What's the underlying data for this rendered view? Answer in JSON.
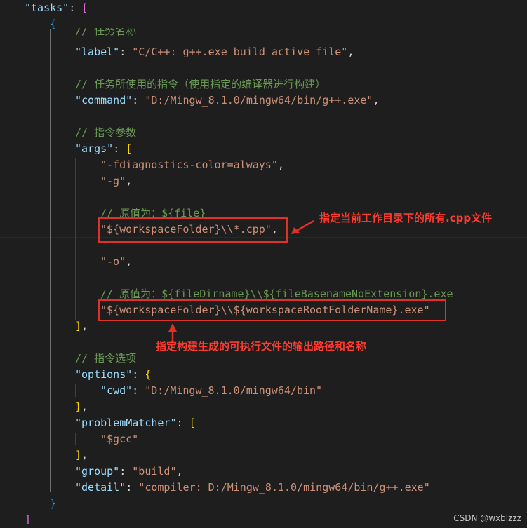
{
  "lines": {
    "l1": {
      "key": "\"tasks\"",
      "colon": ": ",
      "bracket": "["
    },
    "l2": {
      "brace": "{"
    },
    "l3": {
      "comment": "// 任务名称"
    },
    "l4": {
      "key": "\"label\"",
      "colon": ": ",
      "value": "\"C/C++: g++.exe build active file\"",
      "comma": ","
    },
    "l6": {
      "comment": "// 任务所使用的指令（使用指定的编译器进行构建）"
    },
    "l7": {
      "key": "\"command\"",
      "colon": ": ",
      "value": "\"D:/Mingw_8.1.0/mingw64/bin/g++.exe\"",
      "comma": ","
    },
    "l9": {
      "comment": "// 指令参数"
    },
    "l10": {
      "key": "\"args\"",
      "colon": ": ",
      "bracket": "["
    },
    "l11": {
      "value": "\"-fdiagnostics-color=always\"",
      "comma": ","
    },
    "l12": {
      "value": "\"-g\"",
      "comma": ","
    },
    "l14": {
      "comment": "// 原值为：${file}"
    },
    "l15": {
      "value": "\"${workspaceFolder}\\\\*.cpp\"",
      "comma": ","
    },
    "l17": {
      "value": "\"-o\"",
      "comma": ","
    },
    "l19": {
      "comment": "// 原值为：${fileDirname}\\\\${fileBasenameNoExtension}.exe"
    },
    "l20": {
      "value": "\"${workspaceFolder}\\\\${workspaceRootFolderName}.exe\""
    },
    "l21": {
      "bracket": "]",
      "comma": ","
    },
    "l22": {
      "comment": "// 指令选项"
    },
    "l23": {
      "key": "\"options\"",
      "colon": ": ",
      "brace": "{"
    },
    "l24": {
      "key": "\"cwd\"",
      "colon": ": ",
      "value": "\"D:/Mingw_8.1.0/mingw64/bin\""
    },
    "l25": {
      "brace": "}",
      "comma": ","
    },
    "l26": {
      "key": "\"problemMatcher\"",
      "colon": ": ",
      "bracket": "["
    },
    "l27": {
      "value": "\"$gcc\""
    },
    "l28": {
      "bracket": "]",
      "comma": ","
    },
    "l29": {
      "key": "\"group\"",
      "colon": ": ",
      "value": "\"build\"",
      "comma": ","
    },
    "l30": {
      "key": "\"detail\"",
      "colon": ": ",
      "value": "\"compiler: D:/Mingw_8.1.0/mingw64/bin/g++.exe\""
    },
    "l31": {
      "brace": "}"
    },
    "l32": {
      "bracket": "]"
    }
  },
  "annotations": {
    "cpp_note": "指定当前工作目录下的所有.cpp文件",
    "exe_note": "指定构建生成的可执行文件的输出路径和名称"
  },
  "watermark": "CSDN @wxblzzz",
  "colors": {
    "background": "#1e1e1e",
    "key": "#9cdcfe",
    "string": "#ce9178",
    "comment": "#6a9955",
    "bracket_gold": "#ffd700",
    "bracket_pink": "#da70d6",
    "bracket_blue": "#179fff",
    "annotation_red": "#e0302a"
  }
}
